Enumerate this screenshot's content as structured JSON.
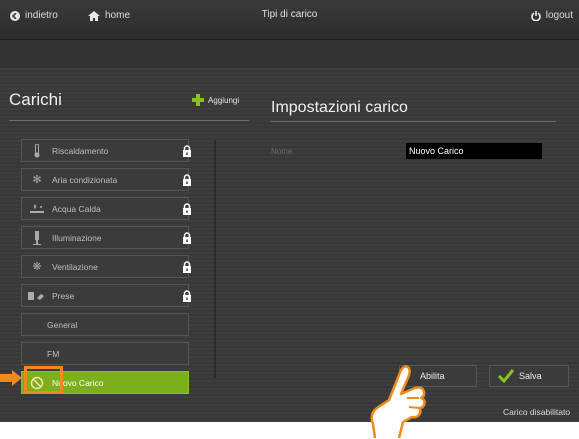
{
  "topbar": {
    "back_label": "indietro",
    "home_label": "home",
    "title": "Tipi di carico",
    "logout_label": "logout"
  },
  "left": {
    "title": "Carichi",
    "add_label": "Aggiungi",
    "items": [
      {
        "label": "Riscaldamento",
        "icon": "thermometer-icon",
        "locked": true
      },
      {
        "label": "Aria condizionata",
        "icon": "snowflake-icon",
        "locked": true
      },
      {
        "label": "Acqua Calda",
        "icon": "water-heater-icon",
        "locked": true
      },
      {
        "label": "Illuminazione",
        "icon": "lamp-icon",
        "locked": true
      },
      {
        "label": "Ventilazione",
        "icon": "fan-icon",
        "locked": true
      },
      {
        "label": "Prese",
        "icon": "plug-icon",
        "locked": true
      },
      {
        "label": "General",
        "icon": "",
        "locked": false
      },
      {
        "label": "FM",
        "icon": "",
        "locked": false
      },
      {
        "label": "Nuovo Carico",
        "icon": "disabled-icon",
        "locked": false,
        "selected": true
      }
    ]
  },
  "right": {
    "title": "Impostazioni carico",
    "name_label": "Nome",
    "name_value": "Nuovo Carico",
    "disable_button": "Abilita",
    "save_button": "Salva",
    "status": "Carico disabilitato"
  },
  "colors": {
    "accent": "#8cc21e",
    "selected_row": "#7bb01c",
    "highlight": "#f08a1c",
    "background": "#3d3d3d"
  }
}
